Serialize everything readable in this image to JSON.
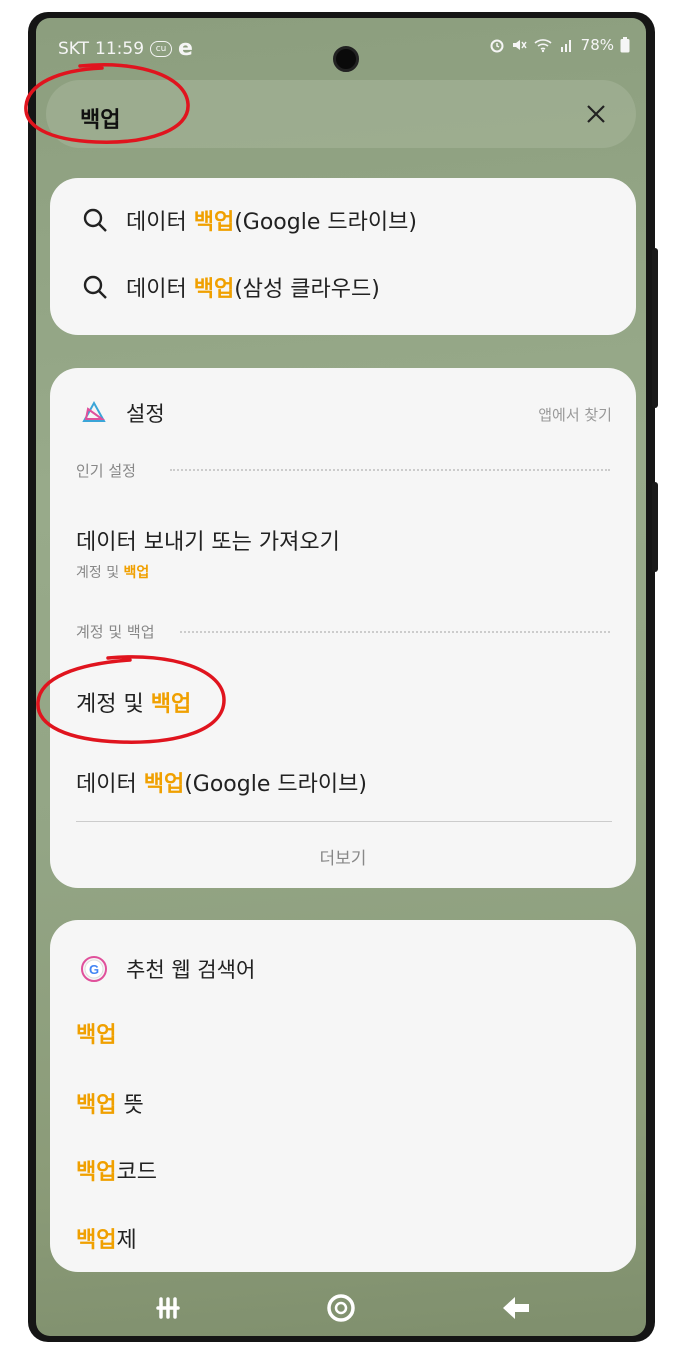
{
  "status": {
    "carrier": "SKT",
    "time": "11:59",
    "battery": "78%"
  },
  "search": {
    "query": "백업"
  },
  "suggestions": [
    {
      "pre": "데이터 ",
      "hl": "백업",
      "post": "(Google 드라이브)"
    },
    {
      "pre": "데이터 ",
      "hl": "백업",
      "post": "(삼성 클라우드)"
    }
  ],
  "settings_card": {
    "app_name": "설정",
    "find_in_app": "앱에서 찾기",
    "popular_label": "인기 설정",
    "popular_item": {
      "title": "데이터 보내기 또는 가져오기",
      "sub_pre": "계정 및 ",
      "sub_hl": "백업"
    },
    "section2_label": "계정 및 백업",
    "item2": {
      "pre": "계정 및 ",
      "hl": "백업"
    },
    "item3": {
      "pre": "데이터 ",
      "hl": "백업",
      "post": "(Google 드라이브)"
    },
    "more_label": "더보기"
  },
  "web_card": {
    "title": "추천 웹 검색어",
    "items": [
      {
        "hl": "백업",
        "post": ""
      },
      {
        "hl": "백업",
        "post": " 뜻"
      },
      {
        "hl": "백업",
        "post": "코드"
      },
      {
        "hl": "백업",
        "post": "제"
      }
    ]
  },
  "colors": {
    "highlight": "#f0a000",
    "annotation": "#e0141e"
  },
  "icons": {
    "settings_app": "settings-app-icon",
    "google_app": "google-icon"
  }
}
